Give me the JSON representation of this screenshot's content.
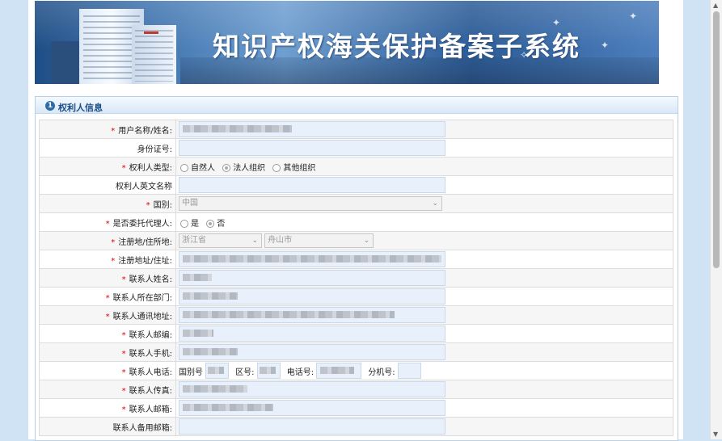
{
  "banner": {
    "title": "知识产权海关保护备案子系统"
  },
  "section": {
    "number": "1",
    "title": "权利人信息"
  },
  "form": {
    "rows": [
      {
        "label": "用户名称/姓名:",
        "required": true
      },
      {
        "label": "身份证号:",
        "required": false
      },
      {
        "label": "权利人类型:",
        "required": true,
        "options": [
          "自然人",
          "法人组织",
          "其他组织"
        ],
        "selected": "法人组织"
      },
      {
        "label": "权利人英文名称",
        "required": false
      },
      {
        "label": "国别:",
        "required": true,
        "value": "中国"
      },
      {
        "label": "是否委托代理人:",
        "required": true,
        "options": [
          "是",
          "否"
        ],
        "selected": "否"
      },
      {
        "label": "注册地/住所地:",
        "required": true,
        "province": "浙江省",
        "city": "舟山市"
      },
      {
        "label": "注册地址/住址:",
        "required": true
      },
      {
        "label": "联系人姓名:",
        "required": true
      },
      {
        "label": "联系人所在部门:",
        "required": true
      },
      {
        "label": "联系人通讯地址:",
        "required": true
      },
      {
        "label": "联系人邮编:",
        "required": true
      },
      {
        "label": "联系人手机:",
        "required": true
      },
      {
        "label": "联系人电话:",
        "required": true,
        "parts": [
          "国别号",
          "区号:",
          "电话号:",
          "分机号:"
        ]
      },
      {
        "label": "联系人传真:",
        "required": true
      },
      {
        "label": "联系人邮箱:",
        "required": true
      },
      {
        "label": "联系人备用邮箱:",
        "required": false
      }
    ],
    "required_mark": "*"
  },
  "colors": {
    "accent": "#1d4d86",
    "required": "#dd0000",
    "input_bg": "#e8f0fb"
  }
}
